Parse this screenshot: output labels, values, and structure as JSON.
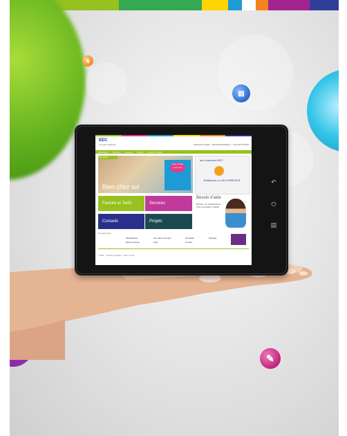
{
  "topbar": {
    "colors": [
      "#e8262b",
      "#96c11f",
      "#34a853",
      "#ffd400",
      "#1e9ad6",
      "#f58220",
      "#a3238e",
      "#2f3f99"
    ]
  },
  "floating_icons": [
    {
      "name": "orange-ball-icon",
      "color": "#f08a1c"
    },
    {
      "name": "blue-ball-icon",
      "color": "#2a6bd0"
    },
    {
      "name": "purple-truck-ball-icon",
      "color": "#8e2aa8"
    },
    {
      "name": "magenta-pencil-ball-icon",
      "color": "#c0247e"
    }
  ],
  "site": {
    "stripe_colors": [
      "#96c11f",
      "#e63a8a",
      "#1e9ad6",
      "#ffd400",
      "#f58220",
      "#2b2f8c"
    ],
    "logo": "EEC",
    "logo_sub": "nouvelle-calédonie",
    "top_links": "ESPACE CLIENT · PROFESSIONNELS · COLLECTIVITÉS",
    "nav": [
      "Particuliers",
      "Services",
      "Conseils",
      "Projets",
      "Facture et Tarifs"
    ],
    "hero_tab": "Particuliers",
    "hero_badge": "Quel contrat pour vous",
    "hero_title": "Bien chez soi",
    "services_title": "les e-services EEC",
    "services_label": "M'abonner à L'AUTORELÈVE",
    "tiles": {
      "facture": "Facture et Tarifs",
      "services": "Services",
      "conseils": "Conseils",
      "projets": "Projets"
    },
    "help_title": "Besoin d'aide",
    "help_text": "Bonjour, Je m'appelle Eva, votre conseillère virtuelle",
    "footer_title": "En savoir plus",
    "footer_cols": [
      [
        "Médiathèque",
        "Espace presse"
      ],
      [
        "Nos offres d'emploi",
        "FAQ"
      ],
      [
        "Actualités",
        "Contact"
      ],
      [
        "Partager",
        ""
      ]
    ],
    "copyright": "© EEC · Mentions légales · Plan du site"
  }
}
